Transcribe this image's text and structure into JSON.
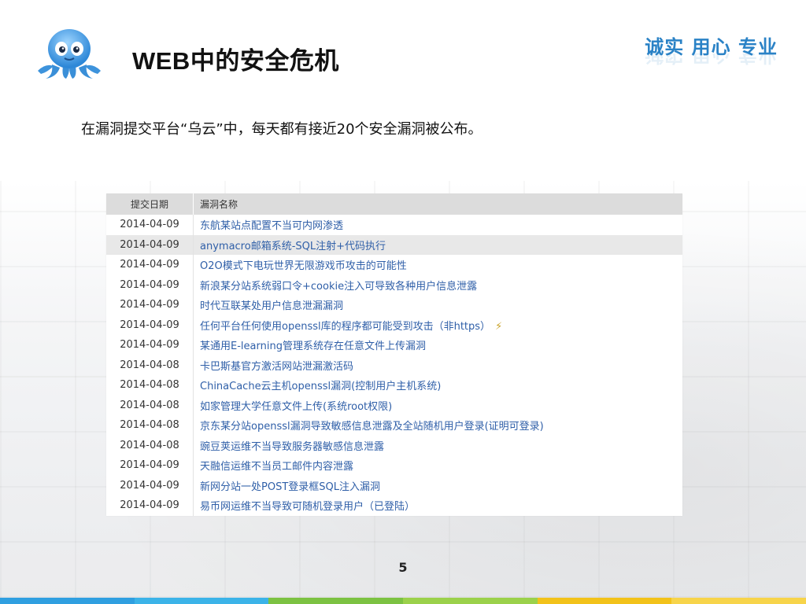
{
  "header": {
    "title": "WEB中的安全危机",
    "slogan": "诚实 用心 专业"
  },
  "description": "在漏洞提交平台“乌云”中，每天都有接近20个安全漏洞被公布。",
  "table": {
    "headers": {
      "date": "提交日期",
      "name": "漏洞名称"
    },
    "rows": [
      {
        "date": "2014-04-09",
        "name": "东航某站点配置不当可内网渗透"
      },
      {
        "date": "2014-04-09",
        "name": "anymacro邮箱系统-SQL注射+代码执行"
      },
      {
        "date": "2014-04-09",
        "name": "O2O模式下电玩世界无限游戏币攻击的可能性"
      },
      {
        "date": "2014-04-09",
        "name": "新浪某分站系统弱口令+cookie注入可导致各种用户信息泄露"
      },
      {
        "date": "2014-04-09",
        "name": "时代互联某处用户信息泄漏漏洞"
      },
      {
        "date": "2014-04-09",
        "name": "任何平台任何使用openssl库的程序都可能受到攻击（非https）"
      },
      {
        "date": "2014-04-09",
        "name": "某通用E-learning管理系统存在任意文件上传漏洞"
      },
      {
        "date": "2014-04-08",
        "name": "卡巴斯基官方激活网站泄漏激活码"
      },
      {
        "date": "2014-04-08",
        "name": "ChinaCache云主机openssl漏洞(控制用户主机系统)"
      },
      {
        "date": "2014-04-08",
        "name": "如家管理大学任意文件上传(系统root权限)"
      },
      {
        "date": "2014-04-08",
        "name": "京东某分站openssl漏洞导致敏感信息泄露及全站随机用户登录(证明可登录)"
      },
      {
        "date": "2014-04-08",
        "name": "豌豆荚运维不当导致服务器敏感信息泄露"
      },
      {
        "date": "2014-04-09",
        "name": "天融信运维不当员工邮件内容泄露"
      },
      {
        "date": "2014-04-09",
        "name": "新网分站一处POST登录框SQL注入漏洞"
      },
      {
        "date": "2014-04-09",
        "name": "易币网运维不当导致可随机登录用户（已登陆）"
      }
    ]
  },
  "page_number": "5",
  "colors": {
    "accent": "#2a82c6",
    "link": "#2f5fa8",
    "bar": [
      "#2f9fe0",
      "#3bb3e8",
      "#7cc242",
      "#9bd14b",
      "#f2c21a",
      "#f7d44a"
    ]
  },
  "icons": {
    "mascot": "octopus-mascot-icon",
    "flag": "lightning-icon"
  }
}
